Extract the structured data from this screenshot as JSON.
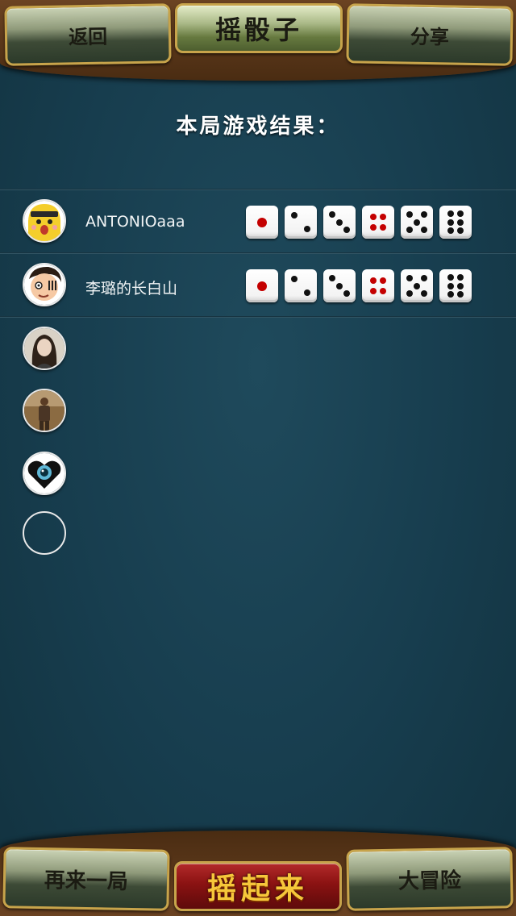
{
  "header": {
    "back_label": "返回",
    "title": "摇骰子",
    "share_label": "分享"
  },
  "result_title": "本局游戏结果：",
  "players": [
    {
      "name": "ANTONIOaaa",
      "avatar": "cartoon-bear-avatar",
      "dice": [
        1,
        2,
        3,
        4,
        5,
        6
      ]
    },
    {
      "name": "李璐的长白山",
      "avatar": "cartoon-face-avatar",
      "dice": [
        1,
        2,
        3,
        4,
        5,
        6
      ]
    }
  ],
  "extra_avatars": [
    "woman-portrait-avatar",
    "man-outdoor-avatar",
    "heart-eye-avatar",
    "empty-avatar"
  ],
  "footer": {
    "again_label": "再来一局",
    "shake_label": "摇起来",
    "adventure_label": "大冒险"
  },
  "colors": {
    "felt": "#1a4050",
    "wood": "#5a3719",
    "gold_border": "#c7a44b",
    "shake_button": "#8a1212",
    "pip_red": "#c40000"
  }
}
